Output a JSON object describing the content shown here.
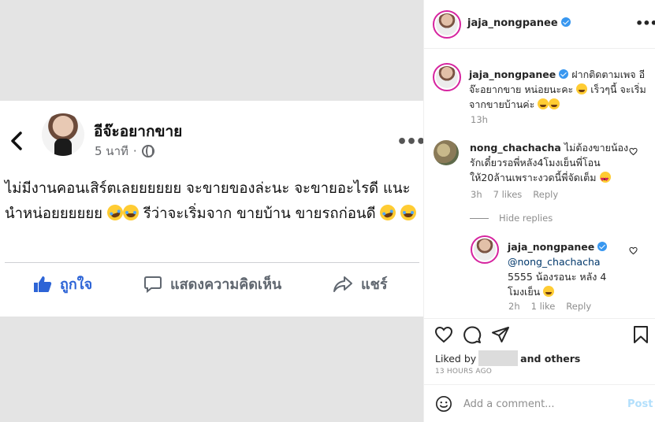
{
  "media": {
    "page_name": "อีจ๊ะอยากขาย",
    "time": "5 นาที",
    "dot": "·",
    "text_1": "ไม่มีงานคอนเสิร์ตเลยยยยยย จะขายของล่ะนะ จะขายอะไรดี แนะนำหน่อยยยยยย",
    "text_2": "รีว่าจะเริ่มจาก ขายบ้าน ขายรถก่อนดี",
    "like_label": "ถูกใจ",
    "comment_label": "แสดงความคิดเห็น",
    "share_label": "แชร์"
  },
  "header": {
    "username": "jaja_nongpanee",
    "more": "•••"
  },
  "caption": {
    "username": "jaja_nongpanee",
    "text_a": "ฝากติดตามเพจ อีจ๊ะอยากขาย หน่อยนะคะ",
    "text_b": "เร็วๆนี้ จะเริ่มจากขายบ้านค่ะ",
    "time": "13h"
  },
  "comments": [
    {
      "username": "nong_chachacha",
      "text": "ไม่ต้องขายน้องรักเดี๋ยวรอพี่หลัง4โมงเย็นพี่โอนให้20ล้านเพราะงวดนี้พี่จัดเต็ม",
      "time": "3h",
      "likes": "7 likes",
      "reply": "Reply"
    }
  ],
  "hide_replies": "Hide replies",
  "reply": {
    "username": "jaja_nongpanee",
    "mention": "@nong_chachacha",
    "text": "5555 น้องรอนะ หลัง 4 โมงเย็น",
    "time": "2h",
    "likes": "1 like",
    "reply": "Reply"
  },
  "liked_by": {
    "prefix": "Liked by",
    "suffix": "and others"
  },
  "timestamp": "13 HOURS AGO",
  "add_comment": {
    "placeholder": "Add a comment...",
    "post": "Post"
  },
  "icons": [
    "back-arrow-icon",
    "globe-icon",
    "more-icon",
    "like-thumb-icon",
    "comment-bubble-icon",
    "share-arrow-icon",
    "verified-icon",
    "heart-icon",
    "comment-icon",
    "send-icon",
    "bookmark-icon",
    "emoji-icon"
  ],
  "colors": {
    "facebook_blue": "#2d64d6",
    "instagram_link": "#00376b",
    "verified": "#3897f0",
    "post_button": "#b2dffc"
  }
}
